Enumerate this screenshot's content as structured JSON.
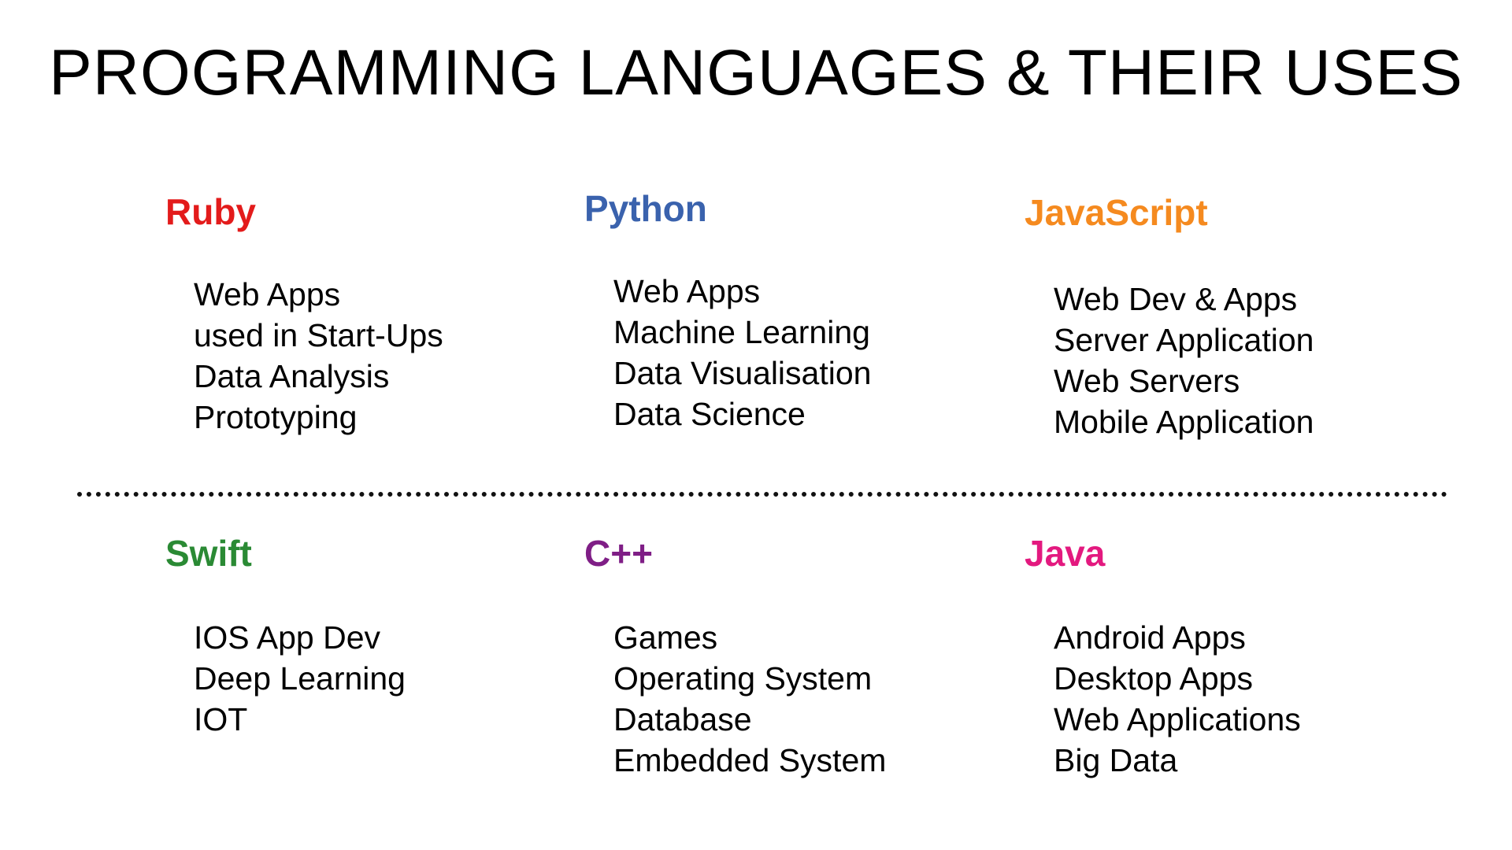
{
  "title": "PROGRAMMING LANGUAGES & THEIR USES",
  "languages": [
    {
      "name": "Ruby",
      "color": "#e31b1b",
      "uses": [
        "Web Apps",
        "used in Start-Ups",
        "Data Analysis",
        "Prototyping"
      ]
    },
    {
      "name": "Python",
      "color": "#3a62ad",
      "uses": [
        "Web Apps",
        "Machine Learning",
        "Data Visualisation",
        "Data Science"
      ]
    },
    {
      "name": "JavaScript",
      "color": "#f58a1f",
      "uses": [
        "Web Dev & Apps",
        "Server Application",
        "Web Servers",
        "Mobile Application"
      ]
    },
    {
      "name": "Swift",
      "color": "#2a8a34",
      "uses": [
        "IOS App Dev",
        "Deep Learning",
        "IOT"
      ]
    },
    {
      "name": "C++",
      "color": "#7f1e86",
      "uses": [
        "Games",
        "Operating System",
        "Database",
        "Embedded System"
      ]
    },
    {
      "name": "Java",
      "color": "#e3197f",
      "uses": [
        "Android Apps",
        "Desktop Apps",
        "Web Applications",
        "Big Data"
      ]
    }
  ]
}
